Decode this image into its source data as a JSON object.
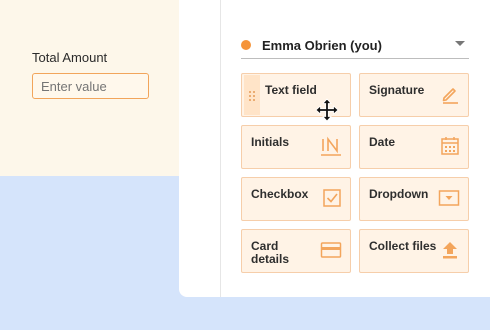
{
  "form": {
    "field_label": "Total Amount",
    "field_placeholder": "Enter value"
  },
  "signer": {
    "name": "Emma Obrien (you)",
    "color": "#f5943a"
  },
  "fields": [
    {
      "label": "Text field",
      "icon": "move-icon"
    },
    {
      "label": "Signature",
      "icon": "pen-icon"
    },
    {
      "label": "Initials",
      "icon": "initials-icon"
    },
    {
      "label": "Date",
      "icon": "calendar-icon"
    },
    {
      "label": "Checkbox",
      "icon": "checkbox-icon"
    },
    {
      "label": "Dropdown",
      "icon": "dropdown-icon"
    },
    {
      "label": "Card details",
      "icon": "credit-card-icon"
    },
    {
      "label": "Collect files",
      "icon": "upload-icon"
    }
  ],
  "theme": {
    "accent": "#f5943a",
    "tile_bg": "#fff3e6",
    "blue_bg": "#d5e4fb",
    "cream_bg": "#fdf7ea"
  }
}
